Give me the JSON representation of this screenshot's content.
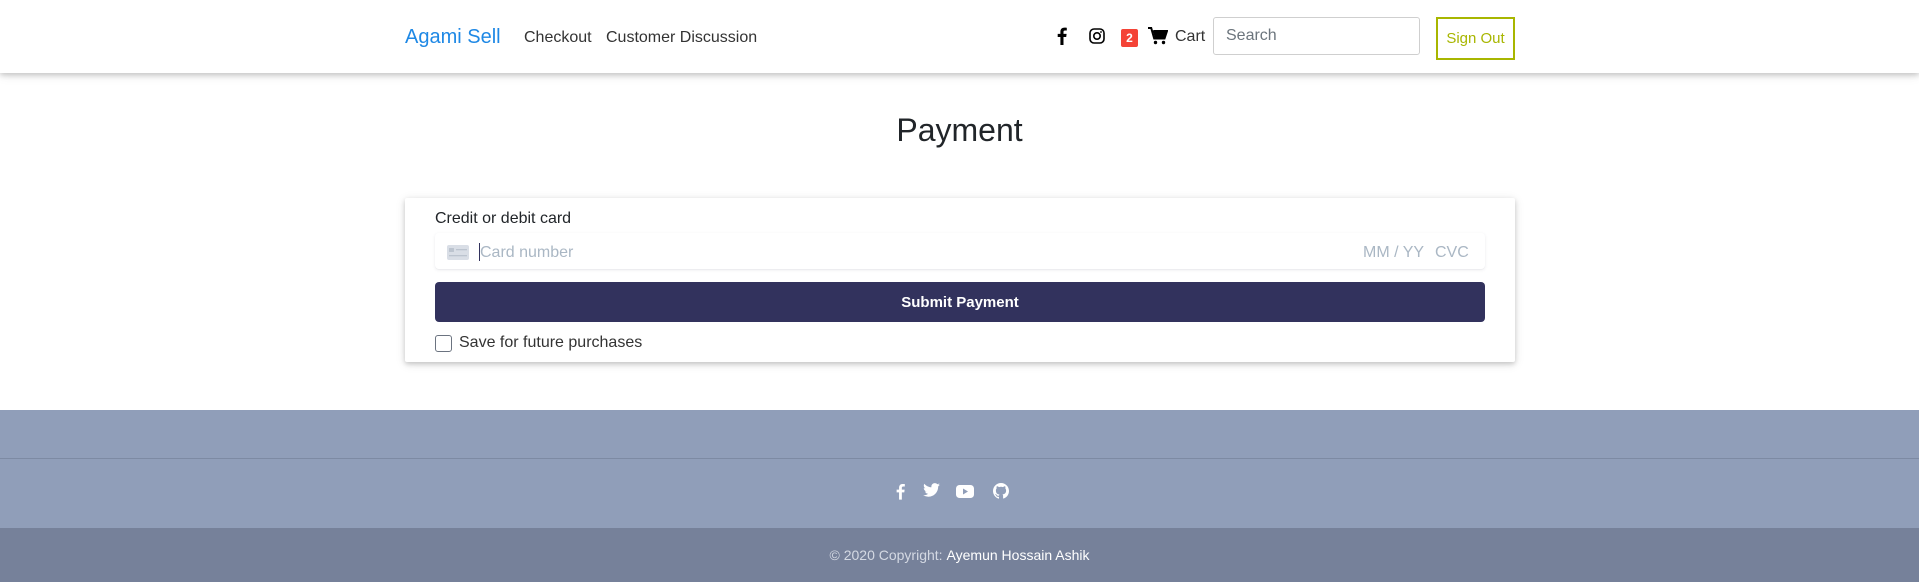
{
  "navbar": {
    "brand": "Agami Sell",
    "links": [
      {
        "label": "Checkout"
      },
      {
        "label": "Customer Discussion"
      }
    ],
    "cart_count": "2",
    "cart_label": "Cart",
    "search_placeholder": "Search",
    "signout_label": "Sign Out",
    "colors": {
      "brand": "#1e88e5",
      "signout": "#a8b600",
      "badge": "#f44336"
    }
  },
  "main": {
    "title": "Payment",
    "card_label": "Credit or debit card",
    "card_number_placeholder": "Card number",
    "expiry_placeholder": "MM / YY",
    "cvc_placeholder": "CVC",
    "submit_label": "Submit Payment",
    "save_label": "Save for future purchases",
    "save_checked": false,
    "colors": {
      "submit_bg": "#32325d"
    }
  },
  "footer": {
    "social_icons": [
      "facebook-icon",
      "twitter-icon",
      "youtube-icon",
      "github-icon"
    ],
    "copyright": "© 2020 Copyright:",
    "author": "Ayemun Hossain Ashik",
    "colors": {
      "top": "#909eb9",
      "bottom": "#76819a"
    }
  }
}
